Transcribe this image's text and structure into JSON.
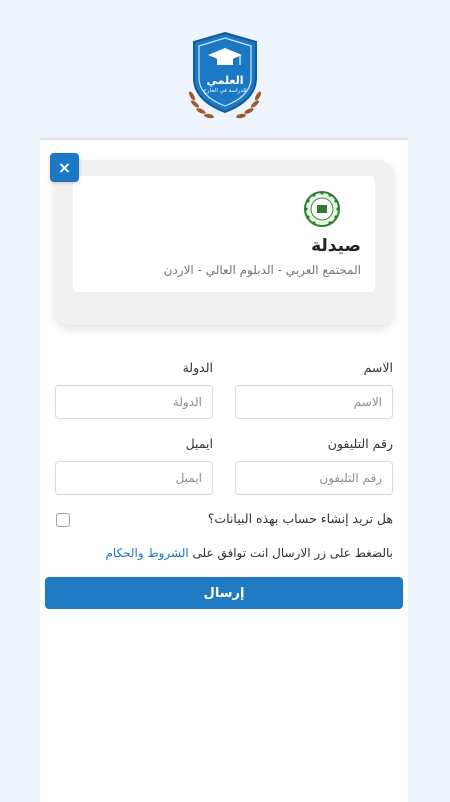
{
  "logo": {
    "title": "العلمي",
    "subtitle": "للدراسة في الخارج",
    "color": "#1a78c4",
    "laurel_color": "#9c5b2c"
  },
  "course": {
    "close_label": "×",
    "title": "صيدلة",
    "subtitle": "المجتمع العربي - الدبلوم العالي - الاردن",
    "seal_icon": "university-seal-icon"
  },
  "form": {
    "name_label": "الاسم",
    "name_placeholder": "الاسم",
    "country_label": "الدولة",
    "country_placeholder": "الدولة",
    "phone_label": "رقم التليفون",
    "phone_placeholder": "رقم التليفون",
    "email_label": "ايميل",
    "email_placeholder": "ايميل",
    "create_account_question": "هل تريد إنشاء حساب بهذه البيانات؟",
    "terms_prefix": "بالضغط على زر الارسال انت توافق على ",
    "terms_link": "الشروط والحكام",
    "submit_label": "إرسال"
  },
  "colors": {
    "accent": "#1f7bc3",
    "background": "#eef4fb"
  }
}
